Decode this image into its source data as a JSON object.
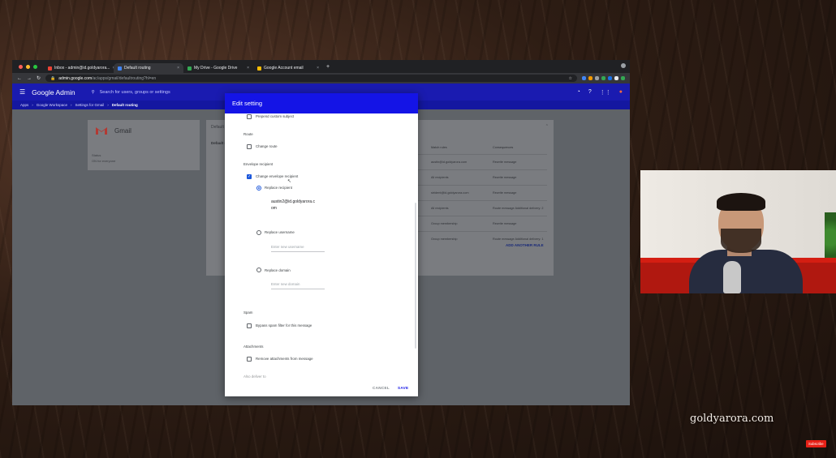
{
  "browser": {
    "tabs": [
      {
        "label": "Inbox - admin@id.goldyarora...",
        "color": "#ea4335",
        "active": false
      },
      {
        "label": "Default routing",
        "color": "#4285f4",
        "active": true
      },
      {
        "label": "My Drive - Google Drive",
        "color": "#34a853",
        "active": false
      },
      {
        "label": "Google Account email",
        "color": "#fbbc05",
        "active": false
      }
    ],
    "url_host": "admin.google.com",
    "url_path": "/ac/apps/gmail/defaultrouting?hl=en"
  },
  "admin": {
    "app_title": "Google Admin",
    "search_placeholder": "Search for users, groups or settings",
    "breadcrumbs": [
      "Apps",
      "Google Workspace",
      "Settings for Gmail",
      "Default routing"
    ],
    "left_card": {
      "app_name": "Gmail",
      "status_label": "Status",
      "status_value": "ON for everyone"
    },
    "right_card": {
      "title": "Default routing",
      "subtitle": "Default routing"
    },
    "rules_table": {
      "headers": [
        "",
        "Match rules",
        "Consequences"
      ],
      "rows": [
        [
          "",
          "austin@id.goldyarora.com",
          "Rewrite message"
        ],
        [
          "",
          "All recipients",
          "Rewrite message"
        ],
        [
          "",
          "strident@id.goldyarora.com",
          "Rewrite message"
        ],
        [
          "",
          "All recipients",
          "Route message Additional delivery: 2"
        ],
        [
          "",
          "Group membership",
          "Rewrite message"
        ],
        [
          "",
          "Group membership",
          "Route message Additional delivery: 1"
        ]
      ],
      "add_rule": "ADD ANOTHER RULE"
    }
  },
  "dialog": {
    "title": "Edit setting",
    "prepend_subject": "Prepend custom subject",
    "route_section": "Route",
    "change_route": "Change route",
    "envelope_section": "Envelope recipient",
    "change_envelope": "Change envelope recipient",
    "replace_recipient": "Replace recipient",
    "recipient_value_1": "austin2@id.goldyarora.c",
    "recipient_value_2": "om",
    "replace_username": "Replace username",
    "username_placeholder": "Enter new username",
    "replace_domain": "Replace domain",
    "domain_placeholder": "Enter new domain",
    "spam_section": "Spam",
    "bypass_spam": "Bypass spam filter for this message",
    "attachments_section": "Attachments",
    "remove_attachments": "Remove attachments from message",
    "also_deliver": "Also deliver to",
    "cancel": "CANCEL",
    "save": "SAVE",
    "accent_color": "#1414e6"
  },
  "overlay": {
    "brand": "goldyarora.com",
    "subscribe": "Subscribe"
  }
}
